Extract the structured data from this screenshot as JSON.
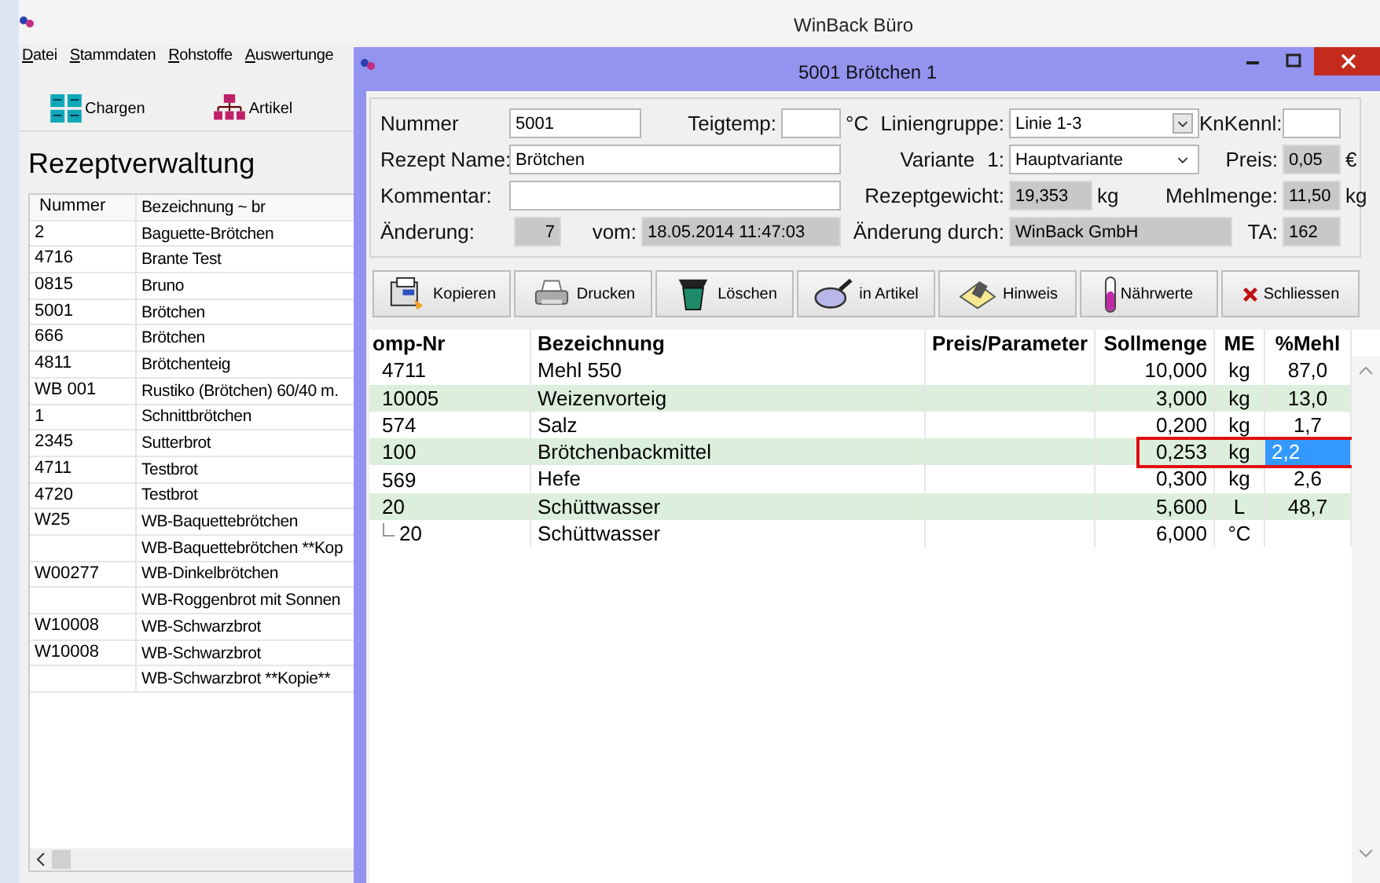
{
  "main_window": {
    "title": "WinBack Büro",
    "menu": [
      "Datei",
      "Stammdaten",
      "Rohstoffe",
      "Auswertunge"
    ],
    "toolbar": [
      {
        "label": "Chargen",
        "kind": "grid"
      },
      {
        "label": "Artikel",
        "kind": "tree"
      }
    ],
    "heading": "Rezeptverwaltung",
    "recipe_list": {
      "columns": [
        "Nummer",
        "Bezeichnung ~ br"
      ],
      "rows": [
        {
          "nummer": "2",
          "bezeichnung": "Baguette-Brötchen"
        },
        {
          "nummer": "4716",
          "bezeichnung": "Brante Test"
        },
        {
          "nummer": "0815",
          "bezeichnung": "Bruno"
        },
        {
          "nummer": "5001",
          "bezeichnung": "Brötchen"
        },
        {
          "nummer": "666",
          "bezeichnung": "Brötchen"
        },
        {
          "nummer": "4811",
          "bezeichnung": "Brötchenteig"
        },
        {
          "nummer": "WB 001",
          "bezeichnung": "Rustiko (Brötchen) 60/40 m."
        },
        {
          "nummer": "1",
          "bezeichnung": "Schnittbrötchen"
        },
        {
          "nummer": "2345",
          "bezeichnung": "Sutterbrot"
        },
        {
          "nummer": "4711",
          "bezeichnung": "Testbrot"
        },
        {
          "nummer": "4720",
          "bezeichnung": "Testbrot"
        },
        {
          "nummer": "W25",
          "bezeichnung": "WB-Baquettebrötchen"
        },
        {
          "bezeichnung": "WB-Baquettebrötchen **Kop"
        },
        {
          "nummer": "W00277",
          "bezeichnung": "WB-Dinkelbrötchen"
        },
        {
          "bezeichnung": "WB-Roggenbrot mit Sonnen"
        },
        {
          "nummer": "W10008",
          "bezeichnung": "WB-Schwarzbrot"
        },
        {
          "nummer": "W10008",
          "bezeichnung": "WB-Schwarzbrot"
        },
        {
          "bezeichnung": "WB-Schwarzbrot **Kopie**"
        }
      ]
    }
  },
  "dialog": {
    "title": "5001 Brötchen 1",
    "form": {
      "nummer": {
        "label": "Nummer",
        "value": "5001",
        "disabled": false
      },
      "teigtemp": {
        "label": "Teigtemp:",
        "unit": "°C",
        "disabled": false
      },
      "liniengruppe": {
        "label": "Liniengruppe:",
        "value": "Linie 1-3"
      },
      "knkennl": {
        "label": "KnKennl:",
        "disabled": false
      },
      "rezept_name": {
        "label": "Rezept Name:",
        "value": "Brötchen",
        "disabled": false
      },
      "variante": {
        "label": "Variante",
        "number": "1:",
        "value": "Hauptvariante"
      },
      "preis": {
        "label": "Preis:",
        "value": "0,05",
        "unit": "€",
        "disabled": true
      },
      "kommentar": {
        "label": "Kommentar:",
        "disabled": false
      },
      "rezeptgewicht": {
        "label": "Rezeptgewicht:",
        "value": "19,353",
        "unit": "kg",
        "disabled": true
      },
      "mehlmenge": {
        "label": "Mehlmenge:",
        "value": "11,50",
        "unit": "kg",
        "disabled": true
      },
      "aenderung": {
        "label": "Änderung:",
        "value": "7",
        "disabled": true
      },
      "vom": {
        "label": "vom:",
        "value": "18.05.2014 11:47:03",
        "disabled": true
      },
      "aenderung_durch": {
        "label": "Änderung durch:",
        "value": "WinBack GmbH",
        "disabled": true
      },
      "ta": {
        "label": "TA:",
        "value": "162",
        "disabled": true
      }
    },
    "toolbar": [
      {
        "label": "Kopieren",
        "kind": "copy"
      },
      {
        "label": "Drucken",
        "kind": "print"
      },
      {
        "label": "Löschen",
        "kind": "delete"
      },
      {
        "label": "in Artikel",
        "kind": "lens"
      },
      {
        "label": "Hinweis",
        "kind": "note"
      },
      {
        "label": "Nährwerte",
        "kind": "tube"
      },
      {
        "label": "Schliessen",
        "kind": "close"
      }
    ],
    "table": {
      "columns": [
        "omp-Nr",
        "Bezeichnung",
        "Preis/Parameter",
        "Sollmenge",
        "ME",
        "%Mehl"
      ],
      "rows": [
        {
          "nr": "4711",
          "name": "Mehl 550",
          "sollmenge": "10,000",
          "me": "kg",
          "mehl": "87,0",
          "selected": false
        },
        {
          "nr": "10005",
          "name": "Weizenvorteig",
          "sollmenge": "3,000",
          "me": "kg",
          "mehl": "13,0",
          "selected": false
        },
        {
          "nr": "574",
          "name": "Salz",
          "sollmenge": "0,200",
          "me": "kg",
          "mehl": "1,7",
          "selected": false
        },
        {
          "nr": "100",
          "name": "Brötchenbackmittel",
          "sollmenge": "0,253",
          "me": "kg",
          "mehl": "2,2",
          "selected": true
        },
        {
          "nr": "569",
          "name": "Hefe",
          "sollmenge": "0,300",
          "me": "kg",
          "mehl": "2,6",
          "selected": false
        },
        {
          "nr": "20",
          "name": "Schüttwasser",
          "sollmenge": "5,600",
          "me": "L",
          "mehl": "48,7",
          "selected": false,
          "children": [
            {
              "nr": "20",
              "name": "Schüttwasser",
              "sollmenge": "6,000",
              "me": "°C",
              "selected": false
            }
          ]
        }
      ]
    }
  }
}
